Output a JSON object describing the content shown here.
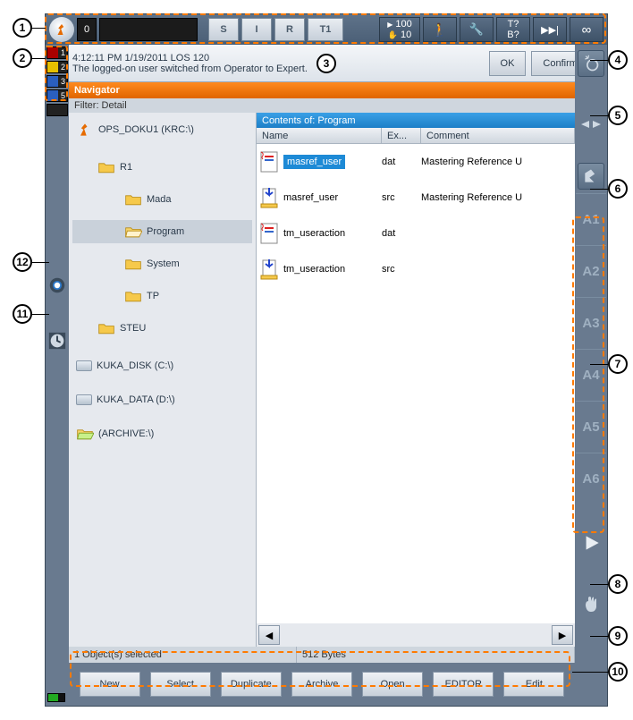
{
  "topbar": {
    "counter": "0",
    "buttons": [
      "S",
      "I",
      "R",
      "T1"
    ],
    "speed_top": "100",
    "speed_bot": "10",
    "tq_top": "T?",
    "tq_bot": "B?",
    "infinity": "∞"
  },
  "side_flags": [
    "1",
    "2",
    "3",
    "5"
  ],
  "message": {
    "time": "4:12:11 PM 1/19/2011 LOS 120",
    "text": "The logged-on user switched from Operator to Expert.",
    "ok": "OK",
    "confirm": "Confirm all"
  },
  "navigator": {
    "title": "Navigator",
    "filter_label": "Filter: Detail",
    "tree": {
      "root": "OPS_DOKU1 (KRC:\\)",
      "r1": "R1",
      "mada": "Mada",
      "program": "Program",
      "system": "System",
      "tp": "TP",
      "steu": "STEU",
      "disk": "KUKA_DISK (C:\\)",
      "data": "KUKA_DATA (D:\\)",
      "archive": "(ARCHIVE:\\)"
    },
    "contents_title": "Contents of: Program",
    "columns": {
      "name": "Name",
      "ext": "Ex...",
      "comment": "Comment"
    },
    "rows": [
      {
        "name": "masref_user",
        "ext": "dat",
        "comment": "Mastering Reference U"
      },
      {
        "name": "masref_user",
        "ext": "src",
        "comment": "Mastering Reference U"
      },
      {
        "name": "tm_useraction",
        "ext": "dat",
        "comment": ""
      },
      {
        "name": "tm_useraction",
        "ext": "src",
        "comment": ""
      }
    ],
    "status_left": "1 Object(s) selected",
    "status_right": "512 Bytes"
  },
  "axes": [
    "A1",
    "A2",
    "A3",
    "A4",
    "A5",
    "A6"
  ],
  "bottom_buttons": [
    "New",
    "Select",
    "Duplicate",
    "Archive",
    "Open",
    "EDITOR",
    "Edit"
  ],
  "callouts": [
    "1",
    "2",
    "3",
    "4",
    "5",
    "6",
    "7",
    "8",
    "9",
    "10",
    "11",
    "12"
  ]
}
